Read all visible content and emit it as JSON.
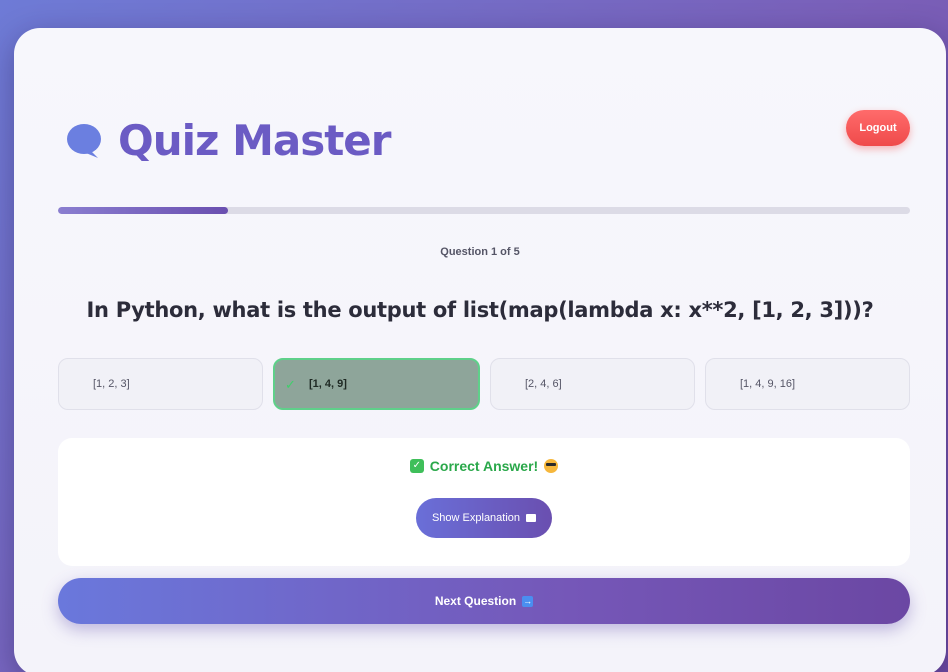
{
  "app": {
    "title": "Quiz Master",
    "logout_label": "Logout"
  },
  "progress": {
    "fraction": 0.2
  },
  "question": {
    "counter": "Question 1 of 5",
    "text": "In Python, what is the output of list(map(lambda x: x**2, [1, 2, 3]))?",
    "options": [
      "[1, 2, 3]",
      "[1, 4, 9]",
      "[2, 4, 6]",
      "[1, 4, 9, 16]"
    ],
    "selected_index": 1
  },
  "feedback": {
    "result_text": "Correct Answer!",
    "explain_label": "Show Explanation"
  },
  "next_label": "Next Question",
  "colors": {
    "accent": "#6b5bc4",
    "logout": "#ef4a4a",
    "correct": "#2aa84a",
    "selected_border": "#5fd08a"
  },
  "icons": [
    "chat-bubble-icon",
    "check-icon",
    "checkbox-checked-icon",
    "sunglasses-face-icon",
    "book-icon",
    "arrow-right-icon"
  ]
}
